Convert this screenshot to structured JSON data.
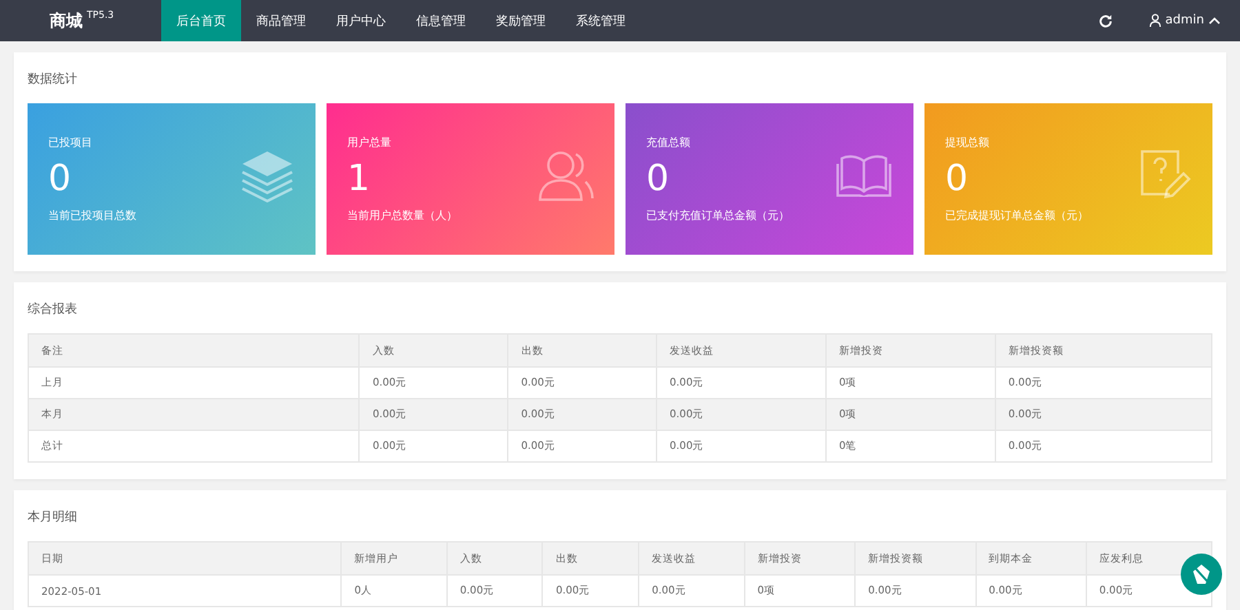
{
  "navbar": {
    "logo": "商城",
    "version": "TP5.3",
    "tabs": [
      {
        "label": "后台首页",
        "selected": true
      },
      {
        "label": "商品管理",
        "selected": false
      },
      {
        "label": "用户中心",
        "selected": false
      },
      {
        "label": "信息管理",
        "selected": false
      },
      {
        "label": "奖励管理",
        "selected": false
      },
      {
        "label": "系统管理",
        "selected": false
      }
    ],
    "user": "admin"
  },
  "stats": {
    "title": "数据统计",
    "cards": [
      {
        "title": "已投项目",
        "value": "0",
        "caption": "当前已投项目总数",
        "kind": "layers"
      },
      {
        "title": "用户总量",
        "value": "1",
        "caption": "当前用户总数量（人）",
        "kind": "users"
      },
      {
        "title": "充值总额",
        "value": "0",
        "caption": "已支付充值订单总金额（元）",
        "kind": "book"
      },
      {
        "title": "提现总额",
        "value": "0",
        "caption": "已完成提现订单总金额（元）",
        "kind": "note"
      }
    ]
  },
  "report": {
    "title": "综合报表",
    "columns": [
      "备注",
      "入数",
      "出数",
      "发送收益",
      "新增投资",
      "新增投资额"
    ],
    "rows": [
      [
        "上月",
        "0.00元",
        "0.00元",
        "0.00元",
        "0项",
        "0.00元"
      ],
      [
        "本月",
        "0.00元",
        "0.00元",
        "0.00元",
        "0项",
        "0.00元"
      ],
      [
        "总计",
        "0.00元",
        "0.00元",
        "0.00元",
        "0笔",
        "0.00元"
      ]
    ]
  },
  "monthly": {
    "title": "本月明细",
    "columns": [
      "日期",
      "新增用户",
      "入数",
      "出数",
      "发送收益",
      "新增投资",
      "新增投资额",
      "到期本金",
      "应发利息"
    ],
    "rows": [
      [
        "2022-05-01",
        "0人",
        "0.00元",
        "0.00元",
        "0.00元",
        "0项",
        "0.00元",
        "0.00元",
        "0.00元"
      ]
    ]
  }
}
